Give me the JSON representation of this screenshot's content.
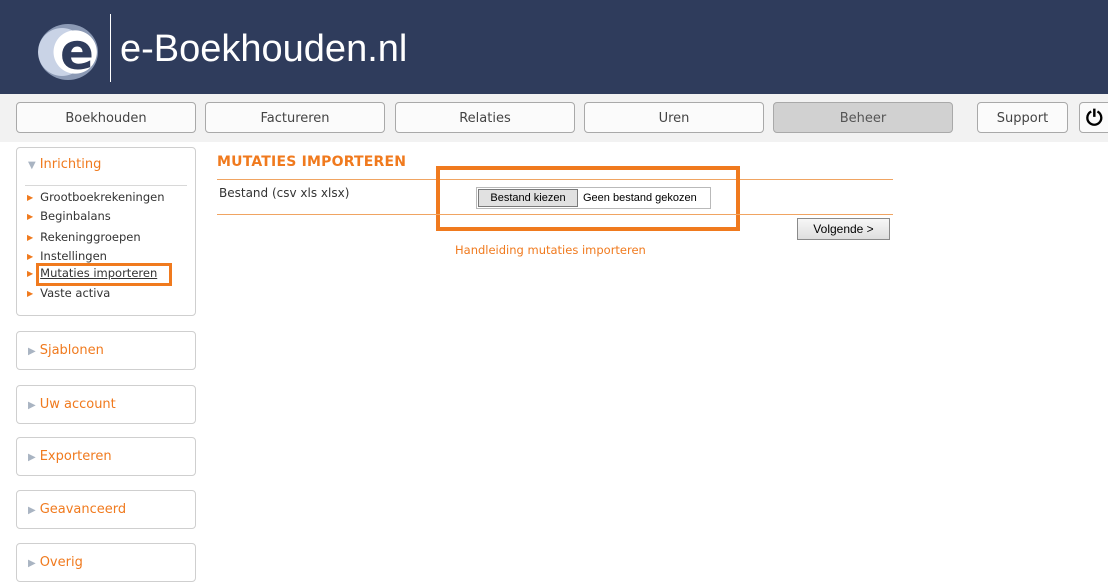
{
  "header": {
    "brand": "e-Boekhouden.nl",
    "logo_letter": "e"
  },
  "nav": {
    "items": [
      "Boekhouden",
      "Factureren",
      "Relaties",
      "Uren",
      "Beheer"
    ],
    "active": "Beheer",
    "support": "Support",
    "power_icon": "power-icon"
  },
  "sidebar": {
    "inrichting": {
      "title": "Inrichting",
      "items": [
        "Grootboekrekeningen",
        "Beginbalans",
        "Rekeninggroepen",
        "Instellingen",
        "Mutaties importeren",
        "Vaste activa"
      ],
      "active": "Mutaties importeren"
    },
    "sections": [
      "Sjablonen",
      "Uw account",
      "Exporteren",
      "Geavanceerd",
      "Overig"
    ]
  },
  "main": {
    "title": "MUTATIES IMPORTEREN",
    "file_label": "Bestand (csv xls xlsx)",
    "file_button": "Bestand kiezen",
    "file_status": "Geen bestand gekozen",
    "next_button": "Volgende >",
    "manual_link": "Handleiding mutaties importeren"
  },
  "colors": {
    "header_bg": "#2f3c5c",
    "accent": "#f07a1e"
  }
}
